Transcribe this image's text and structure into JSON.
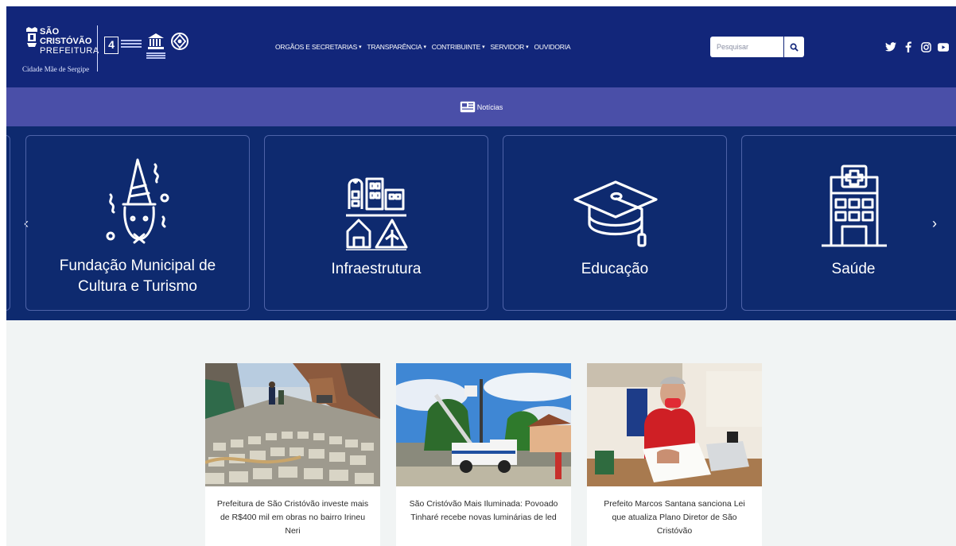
{
  "header": {
    "logo": {
      "line1": "SÃO",
      "line2": "CRISTÓVÃO",
      "line3": "PREFEITURA",
      "tagline": "Cidade Mãe de Sergipe",
      "badge_number": "4"
    },
    "nav": [
      {
        "label": "ORGÃOS E SECRETARIAS",
        "dropdown": true
      },
      {
        "label": "TRANSPARÊNCIA",
        "dropdown": true
      },
      {
        "label": "CONTRIBUINTE",
        "dropdown": true
      },
      {
        "label": "SERVIDOR",
        "dropdown": true
      },
      {
        "label": "OUVIDORIA",
        "dropdown": false
      }
    ],
    "search": {
      "placeholder": "Pesquisar",
      "icon": "search-icon"
    },
    "socials": [
      "twitter-icon",
      "facebook-icon",
      "instagram-icon",
      "youtube-icon"
    ]
  },
  "news_bar": {
    "label": "Notícias",
    "icon": "newspaper-icon"
  },
  "carousel": {
    "cards": [
      {
        "line1": "Fundação Municipal de",
        "line2": "Cultura e Turismo",
        "icon": "festive-mask-icon"
      },
      {
        "line1": "Infraestrutura",
        "line2": "",
        "icon": "buildings-icon"
      },
      {
        "line1": "Educação",
        "line2": "",
        "icon": "graduation-cap-icon"
      },
      {
        "line1": "Saúde",
        "line2": "",
        "icon": "hospital-icon"
      }
    ],
    "prev_icon": "‹",
    "next_icon": "›"
  },
  "news": [
    {
      "title": "Prefeitura de São Cristóvão investe mais de R$400 mil em obras no bairro Irineu Neri",
      "image": "cobblestone-street-photo"
    },
    {
      "title": "São Cristóvão Mais Iluminada: Povoado Tinharé recebe novas luminárias de led",
      "image": "bucket-truck-photo"
    },
    {
      "title": "Prefeito Marcos Santana sanciona Lei que atualiza Plano Diretor de São Cristóvão",
      "image": "mayor-signing-photo"
    }
  ],
  "colors": {
    "header_bg": "#12267a",
    "news_bar_bg": "#4a4fa8",
    "carousel_bg": "#0e2a6f",
    "section_bg": "#f1f4f4"
  }
}
